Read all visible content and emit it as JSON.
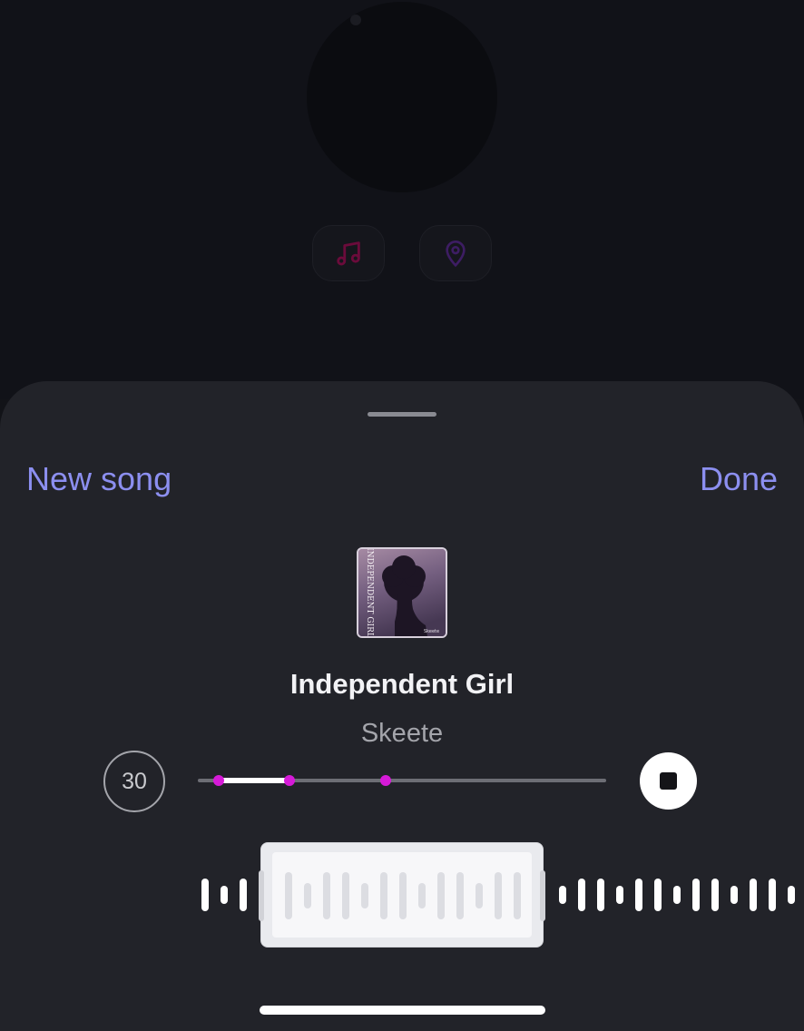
{
  "background": {
    "chips": [
      {
        "icon": "music-note-icon",
        "color": "#6b0b3b"
      },
      {
        "icon": "location-pin-icon",
        "color": "#3d1d63"
      }
    ]
  },
  "sheet": {
    "new_song_label": "New song",
    "done_label": "Done",
    "accent_color": "#8c8ff0"
  },
  "song": {
    "title": "Independent Girl",
    "artist": "Skeete",
    "album_art_text": "INDEPENDENT GIRL",
    "album_art_label": "Skeete"
  },
  "player": {
    "clip_duration": "30",
    "selection_start_fraction": 0.05,
    "selection_end_fraction": 0.225,
    "marker_fraction": 0.46,
    "marker_color": "#d61ad8",
    "state": "playing"
  }
}
